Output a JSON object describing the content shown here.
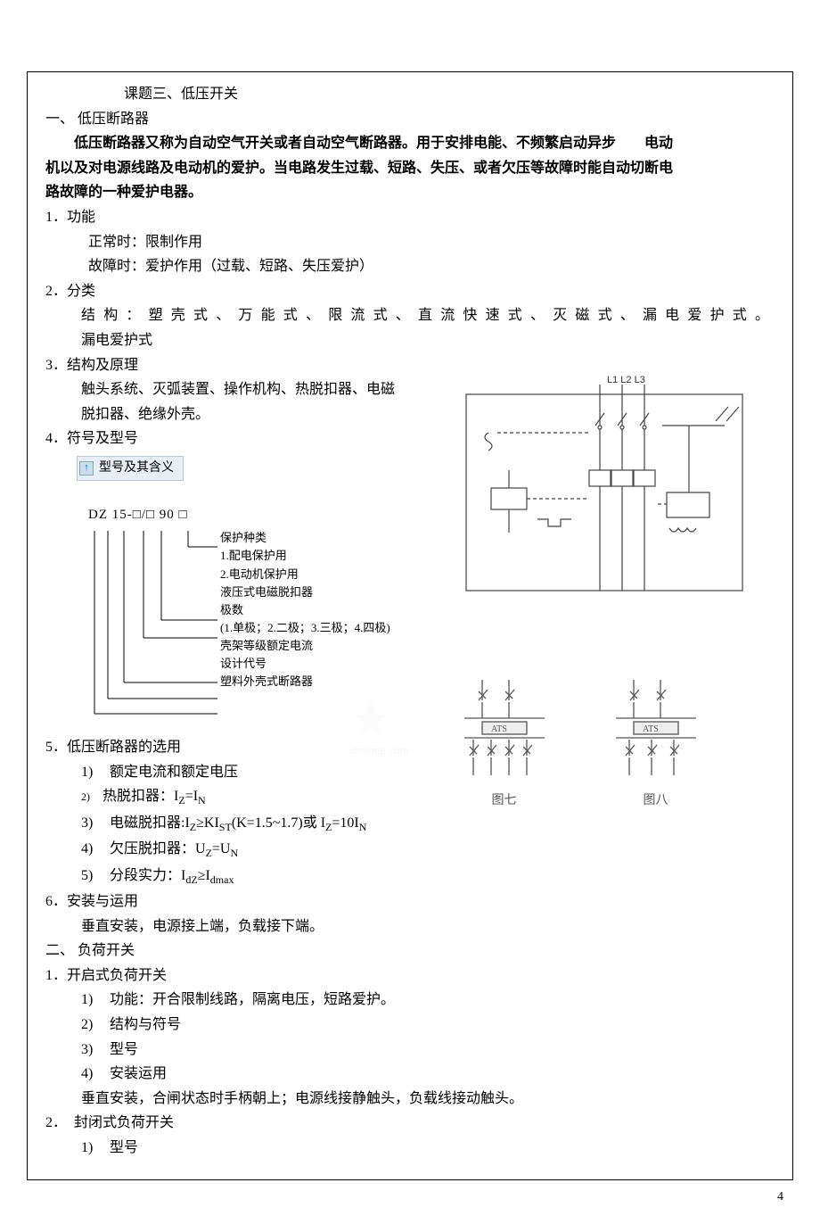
{
  "title": "课题三、低压开关",
  "section1": {
    "heading": "一、 低压断路器",
    "intro_line1": "低压断路器又称为自动空气开关或者自动空气断路器。用于安排电能、不频繁启动异步　　电动",
    "intro_line2": "机以及对电源线路及电动机的爱护。当电路发生过载、短路、失压、或者欠压等故障时能自动切断电",
    "intro_line3": "路故障的一种爱护电器。",
    "items": {
      "i1": "1．功能",
      "i1a": "正常时：限制作用",
      "i1b": "故障时：爱护作用（过载、短路、失压爱护）",
      "i2": "2．分类",
      "i2a": "结构：塑壳式、万能式、限流式、直流快速式、灭磁式、漏电爱护式。",
      "i2b": "漏电爱护式",
      "i3": "3．结构及原理",
      "i3a": "触头系统、灭弧装置、操作机构、热脱扣器、电磁",
      "i3b": "脱扣器、绝缘外壳。",
      "i4": "4．符号及型号",
      "i4badge": "型号及其含义",
      "model_code": "DZ 15-□/□ 90 □",
      "labels": {
        "l1": "保护种类",
        "l1a": "1.配电保护用",
        "l1b": "2.电动机保护用",
        "l2": "液压式电磁脱扣器",
        "l3": "极数",
        "l3a": "(1.单极；2.二极；3.三极；4.四极)",
        "l4": "壳架等级额定电流",
        "l5": "设计代号",
        "l6": "塑料外壳式断路器"
      },
      "i5": "5．低压断路器的选用",
      "i5_1": "额定电流和额定电压",
      "i5_2": "热脱扣器：I<sub>Z</sub>=I<sub>N</sub>",
      "i5_3": "电磁脱扣器:I<sub>Z</sub>≥KI<sub>ST</sub>(K=1.5~1.7)或 I<sub>Z</sub>=10I<sub>N</sub>",
      "i5_4": "欠压脱扣器：U<sub>Z</sub>=U<sub>N</sub>",
      "i5_5": "分段实力：I<sub>dZ</sub>≥I<sub>dmax</sub>",
      "i6": "6．安装与运用",
      "i6a": "垂直安装，电源接上端，负载接下端。"
    }
  },
  "section2": {
    "heading": "二、 负荷开关",
    "s1": "1．开启式负荷开关",
    "s1_1": "功能：开合限制线路，隔离电压，短路爱护。",
    "s1_2": "结构与符号",
    "s1_3": "型号",
    "s1_4": "安装运用",
    "s1_note": "垂直安装，合闸状态时手柄朝上；电源线接静触头，负载线接动触头。",
    "s2": "2．　封闭式负荷开关",
    "s2_1": "型号"
  },
  "right": {
    "top_labels": "L1 L2 L3",
    "sym1": "图七",
    "sym2": "图八",
    "ats": "ATS"
  },
  "page_number": "4",
  "watermark": "zhulong.com"
}
